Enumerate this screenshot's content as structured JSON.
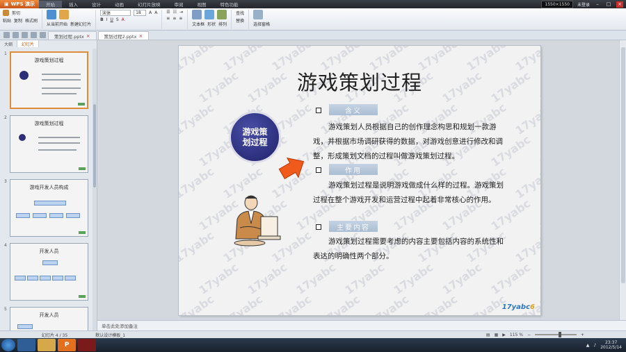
{
  "app": {
    "name": "WPS 演示",
    "menus": [
      "开始",
      "插入",
      "设计",
      "动画",
      "幻灯片放映",
      "审阅",
      "视图",
      "特色功能"
    ],
    "active_menu": "开始",
    "window_info": "1550×1550",
    "account": "未登录"
  },
  "ribbon": {
    "paste": "粘贴",
    "cut": "剪切",
    "copy": "复制",
    "format_painter": "格式刷",
    "from_current": "从当前开始",
    "new_slide": "新建幻灯片",
    "font_name": "宋体",
    "font_size": "18",
    "text_box": "文本框",
    "shapes": "形状",
    "arrange": "排列",
    "find": "查找",
    "replace": "替换",
    "select_pane": "选择窗格"
  },
  "doc_tabs": [
    {
      "label": "策划过程.pptx",
      "active": false
    },
    {
      "label": "策划过程2.pptx",
      "active": true
    }
  ],
  "left_panel": {
    "tabs": [
      "大纲",
      "幻灯片"
    ],
    "active_tab": "幻灯片",
    "thumbs": [
      {
        "num": "1",
        "title": "游戏策划过程"
      },
      {
        "num": "2",
        "title": "游戏策划过程"
      },
      {
        "num": "3",
        "title": "游戏开发人员构成"
      },
      {
        "num": "4",
        "title": "开发人员"
      },
      {
        "num": "5",
        "title": "开发人员"
      }
    ],
    "selected": "1"
  },
  "slide": {
    "title": "游戏策划过程",
    "circle_label": "游戏策划过程",
    "sections": [
      {
        "heading": "含义",
        "text": "游戏策划人员根据自己的创作理念构思和规划一款游戏，并根据市场调研获得的数据，对游戏创意进行修改和调整，形成策划文档的过程叫做游戏策划过程。"
      },
      {
        "heading": "作用",
        "text": "游戏策划过程是说明游戏做成什么样的过程。游戏策划过程在整个游戏开发和运营过程中起着非常核心的作用。"
      },
      {
        "heading": "主要内容",
        "text": "游戏策划过程需要考虑的内容主要包括内容的系统性和表达的明确性两个部分。"
      }
    ],
    "watermark": "17yabc",
    "logo_main": "17yabc",
    "logo_suffix": "6"
  },
  "notes_placeholder": "单击此处添加备注",
  "status": {
    "slide_count": "幻灯片 4 / 35",
    "theme": "默认设计模板_1",
    "zoom": "115 %"
  },
  "taskbar": {
    "time": "23:37",
    "date": "2012/5/14"
  },
  "colors": {
    "accent": "#e2701f",
    "circle": "#2c2f78",
    "heading_box": "#b7c7da"
  }
}
